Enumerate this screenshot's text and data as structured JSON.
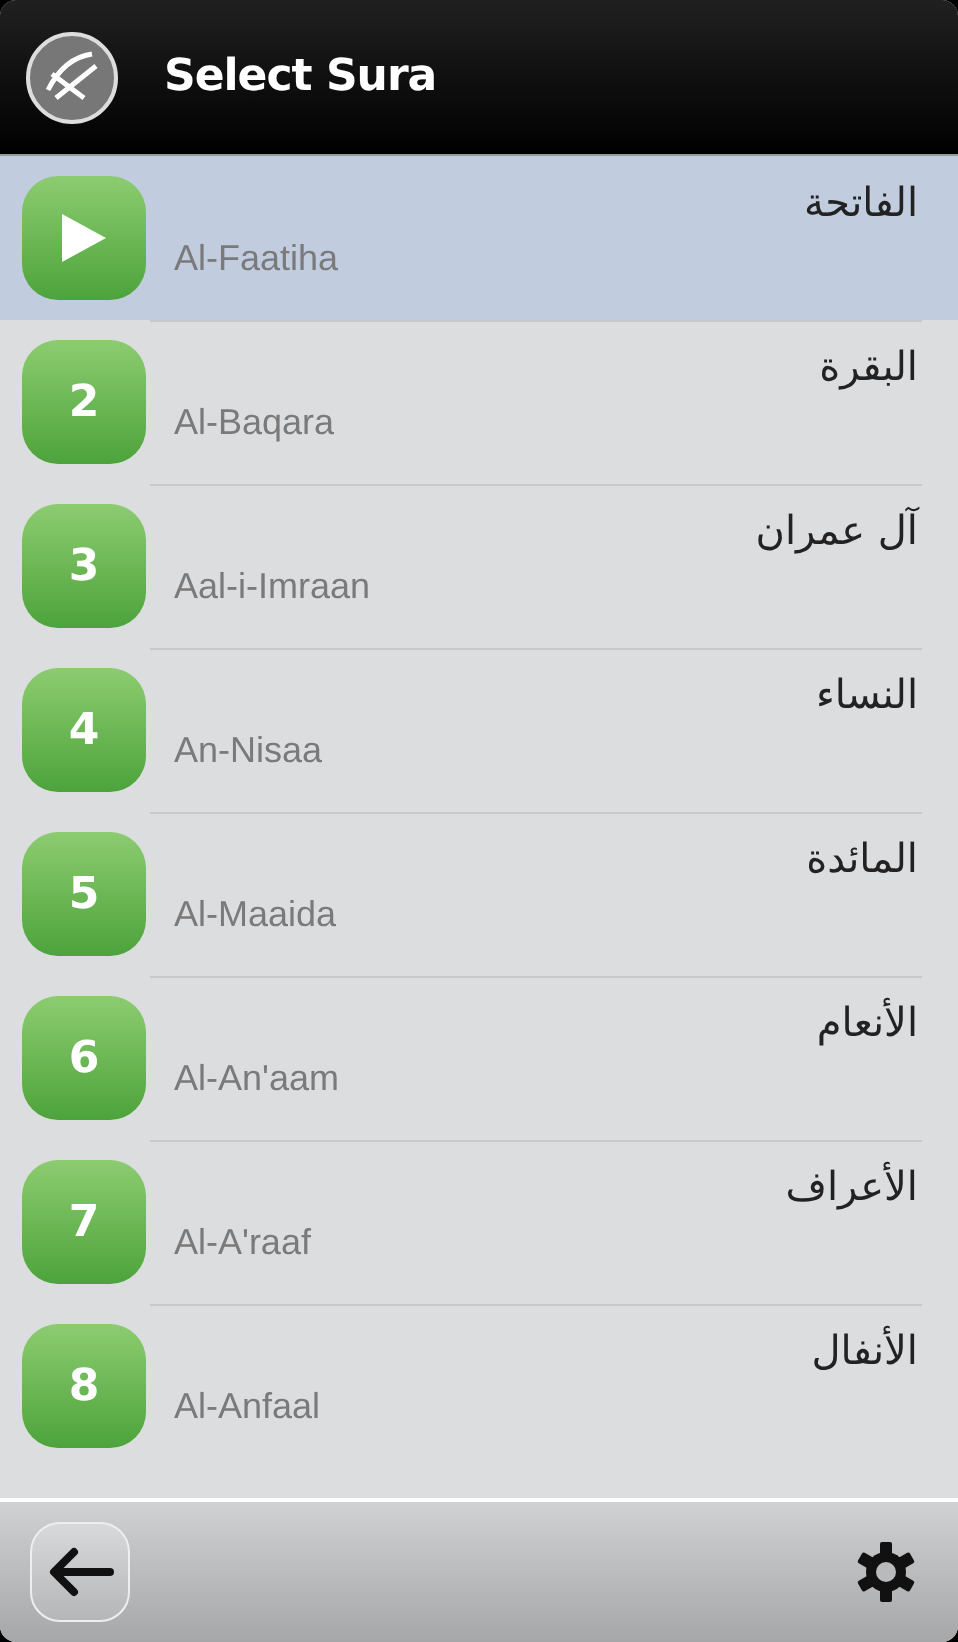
{
  "header": {
    "title": "Select Sura"
  },
  "suras": [
    {
      "kind": "play",
      "arabic": "الفاتحة",
      "name": "Al-Faatiha",
      "selected": true
    },
    {
      "kind": "number",
      "number": "2",
      "arabic": "البقرة",
      "name": "Al-Baqara",
      "selected": false
    },
    {
      "kind": "number",
      "number": "3",
      "arabic": "آل عمران",
      "name": "Aal-i-Imraan",
      "selected": false
    },
    {
      "kind": "number",
      "number": "4",
      "arabic": "النساء",
      "name": "An-Nisaa",
      "selected": false
    },
    {
      "kind": "number",
      "number": "5",
      "arabic": "المائدة",
      "name": "Al-Maaida",
      "selected": false
    },
    {
      "kind": "number",
      "number": "6",
      "arabic": "الأنعام",
      "name": "Al-An'aam",
      "selected": false
    },
    {
      "kind": "number",
      "number": "7",
      "arabic": "الأعراف",
      "name": "Al-A'raaf",
      "selected": false
    },
    {
      "kind": "number",
      "number": "8",
      "arabic": "الأنفال",
      "name": "Al-Anfaal",
      "selected": false
    }
  ]
}
